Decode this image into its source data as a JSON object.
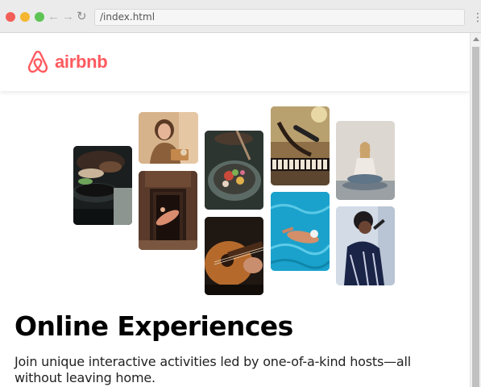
{
  "browser": {
    "address": "/index.html",
    "menu_glyph": "⋮"
  },
  "header": {
    "logo_text": "airbnb",
    "brand_color": "#ff5a5f"
  },
  "main": {
    "title": "Online Experiences",
    "subtitle": "Join unique interactive activities led by one-of-a-kind hosts—all without leaving home."
  },
  "photos": [
    {
      "name": "cooking-photo"
    },
    {
      "name": "host-woman-photo"
    },
    {
      "name": "dancer-photo"
    },
    {
      "name": "food-bowl-photo"
    },
    {
      "name": "guitar-photo"
    },
    {
      "name": "keyboard-microphone-photo"
    },
    {
      "name": "swimmer-photo"
    },
    {
      "name": "yoga-photo"
    },
    {
      "name": "singer-photo"
    }
  ],
  "icons": {
    "back": "back-arrow-icon",
    "forward": "forward-arrow-icon",
    "reload": "reload-icon",
    "menu": "kebab-menu-icon"
  }
}
